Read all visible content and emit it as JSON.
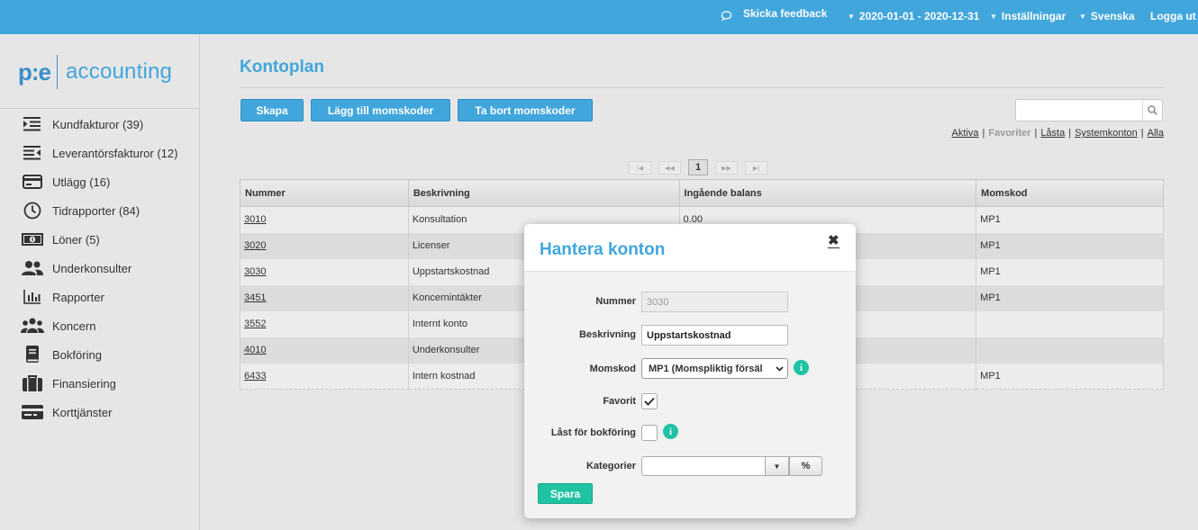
{
  "topbar": {
    "feedback": "Skicka feedback",
    "period": "2020-01-01 - 2020-12-31",
    "settings": "Inställningar",
    "language": "Svenska",
    "logout": "Logga ut"
  },
  "logo": {
    "pe": "p:e",
    "text": "accounting"
  },
  "sidebar": {
    "items": [
      {
        "label": "Kundfakturor (39)",
        "icon": "customer-invoices-icon"
      },
      {
        "label": "Leverantörsfakturor (12)",
        "icon": "supplier-invoices-icon"
      },
      {
        "label": "Utlägg (16)",
        "icon": "expenses-icon"
      },
      {
        "label": "Tidrapporter (84)",
        "icon": "clock-icon"
      },
      {
        "label": "Löner (5)",
        "icon": "salary-icon"
      },
      {
        "label": "Underkonsulter",
        "icon": "users-icon"
      },
      {
        "label": "Rapporter",
        "icon": "chart-icon"
      },
      {
        "label": "Koncern",
        "icon": "group-icon"
      },
      {
        "label": "Bokföring",
        "icon": "book-icon"
      },
      {
        "label": "Finansiering",
        "icon": "briefcase-icon"
      },
      {
        "label": "Korttjänster",
        "icon": "card-icon"
      }
    ]
  },
  "main": {
    "title": "Kontoplan",
    "buttons": {
      "create": "Skapa",
      "add_vat": "Lägg till momskoder",
      "remove_vat": "Ta bort momskoder"
    },
    "filters": {
      "active": "Aktiva",
      "favorites": "Favoriter",
      "locked": "Låsta",
      "system": "Systemkonton",
      "all": "Alla"
    },
    "pager": {
      "current": "1"
    },
    "table": {
      "headers": [
        "Nummer",
        "Beskrivning",
        "Ingående balans",
        "Momskod"
      ],
      "rows": [
        {
          "number": "3010",
          "description": "Konsultation",
          "balance": "0.00",
          "vat": "MP1"
        },
        {
          "number": "3020",
          "description": "Licenser",
          "balance": "",
          "vat": "MP1"
        },
        {
          "number": "3030",
          "description": "Uppstartskostnad",
          "balance": "",
          "vat": "MP1"
        },
        {
          "number": "3451",
          "description": "Koncernintäkter",
          "balance": "",
          "vat": "MP1"
        },
        {
          "number": "3552",
          "description": "Internt konto",
          "balance": "",
          "vat": ""
        },
        {
          "number": "4010",
          "description": "Underkonsulter",
          "balance": "",
          "vat": ""
        },
        {
          "number": "6433",
          "description": "Intern kostnad",
          "balance": "",
          "vat": "MP1"
        }
      ]
    }
  },
  "modal": {
    "title": "Hantera konton",
    "labels": {
      "number": "Nummer",
      "description": "Beskrivning",
      "vat": "Momskod",
      "favorite": "Favorit",
      "locked": "Låst för bokföring",
      "categories": "Kategorier"
    },
    "values": {
      "number": "3030",
      "description": "Uppstartskostnad",
      "vat_selected": "MP1 (Momspliktig försäl",
      "favorite_checked": true,
      "locked_checked": false,
      "categories": ""
    },
    "percent_button": "%",
    "save": "Spara",
    "close_glyph": "✖"
  },
  "colors": {
    "brand": "#41a6dc",
    "accent_green": "#1fc3a3"
  }
}
